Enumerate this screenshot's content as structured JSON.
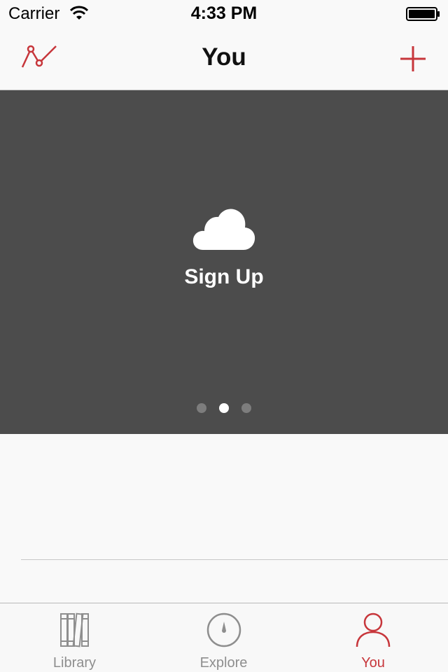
{
  "status_bar": {
    "carrier": "Carrier",
    "time": "4:33 PM",
    "wifi_icon": "wifi-icon",
    "battery_icon": "battery-icon"
  },
  "nav": {
    "title": "You",
    "left_icon": "stats-chart-icon",
    "right_icon": "plus-icon"
  },
  "banner": {
    "icon": "cloud-icon",
    "label": "Sign Up",
    "pages": 3,
    "current_page": 2
  },
  "tabs": [
    {
      "label": "Library",
      "icon": "books-icon",
      "active": false
    },
    {
      "label": "Explore",
      "icon": "compass-icon",
      "active": false
    },
    {
      "label": "You",
      "icon": "person-icon",
      "active": true
    }
  ],
  "colors": {
    "accent": "#c7363b",
    "banner_bg": "#4c4c4c",
    "background": "#f9f9f9",
    "inactive": "#8e8e8e"
  }
}
